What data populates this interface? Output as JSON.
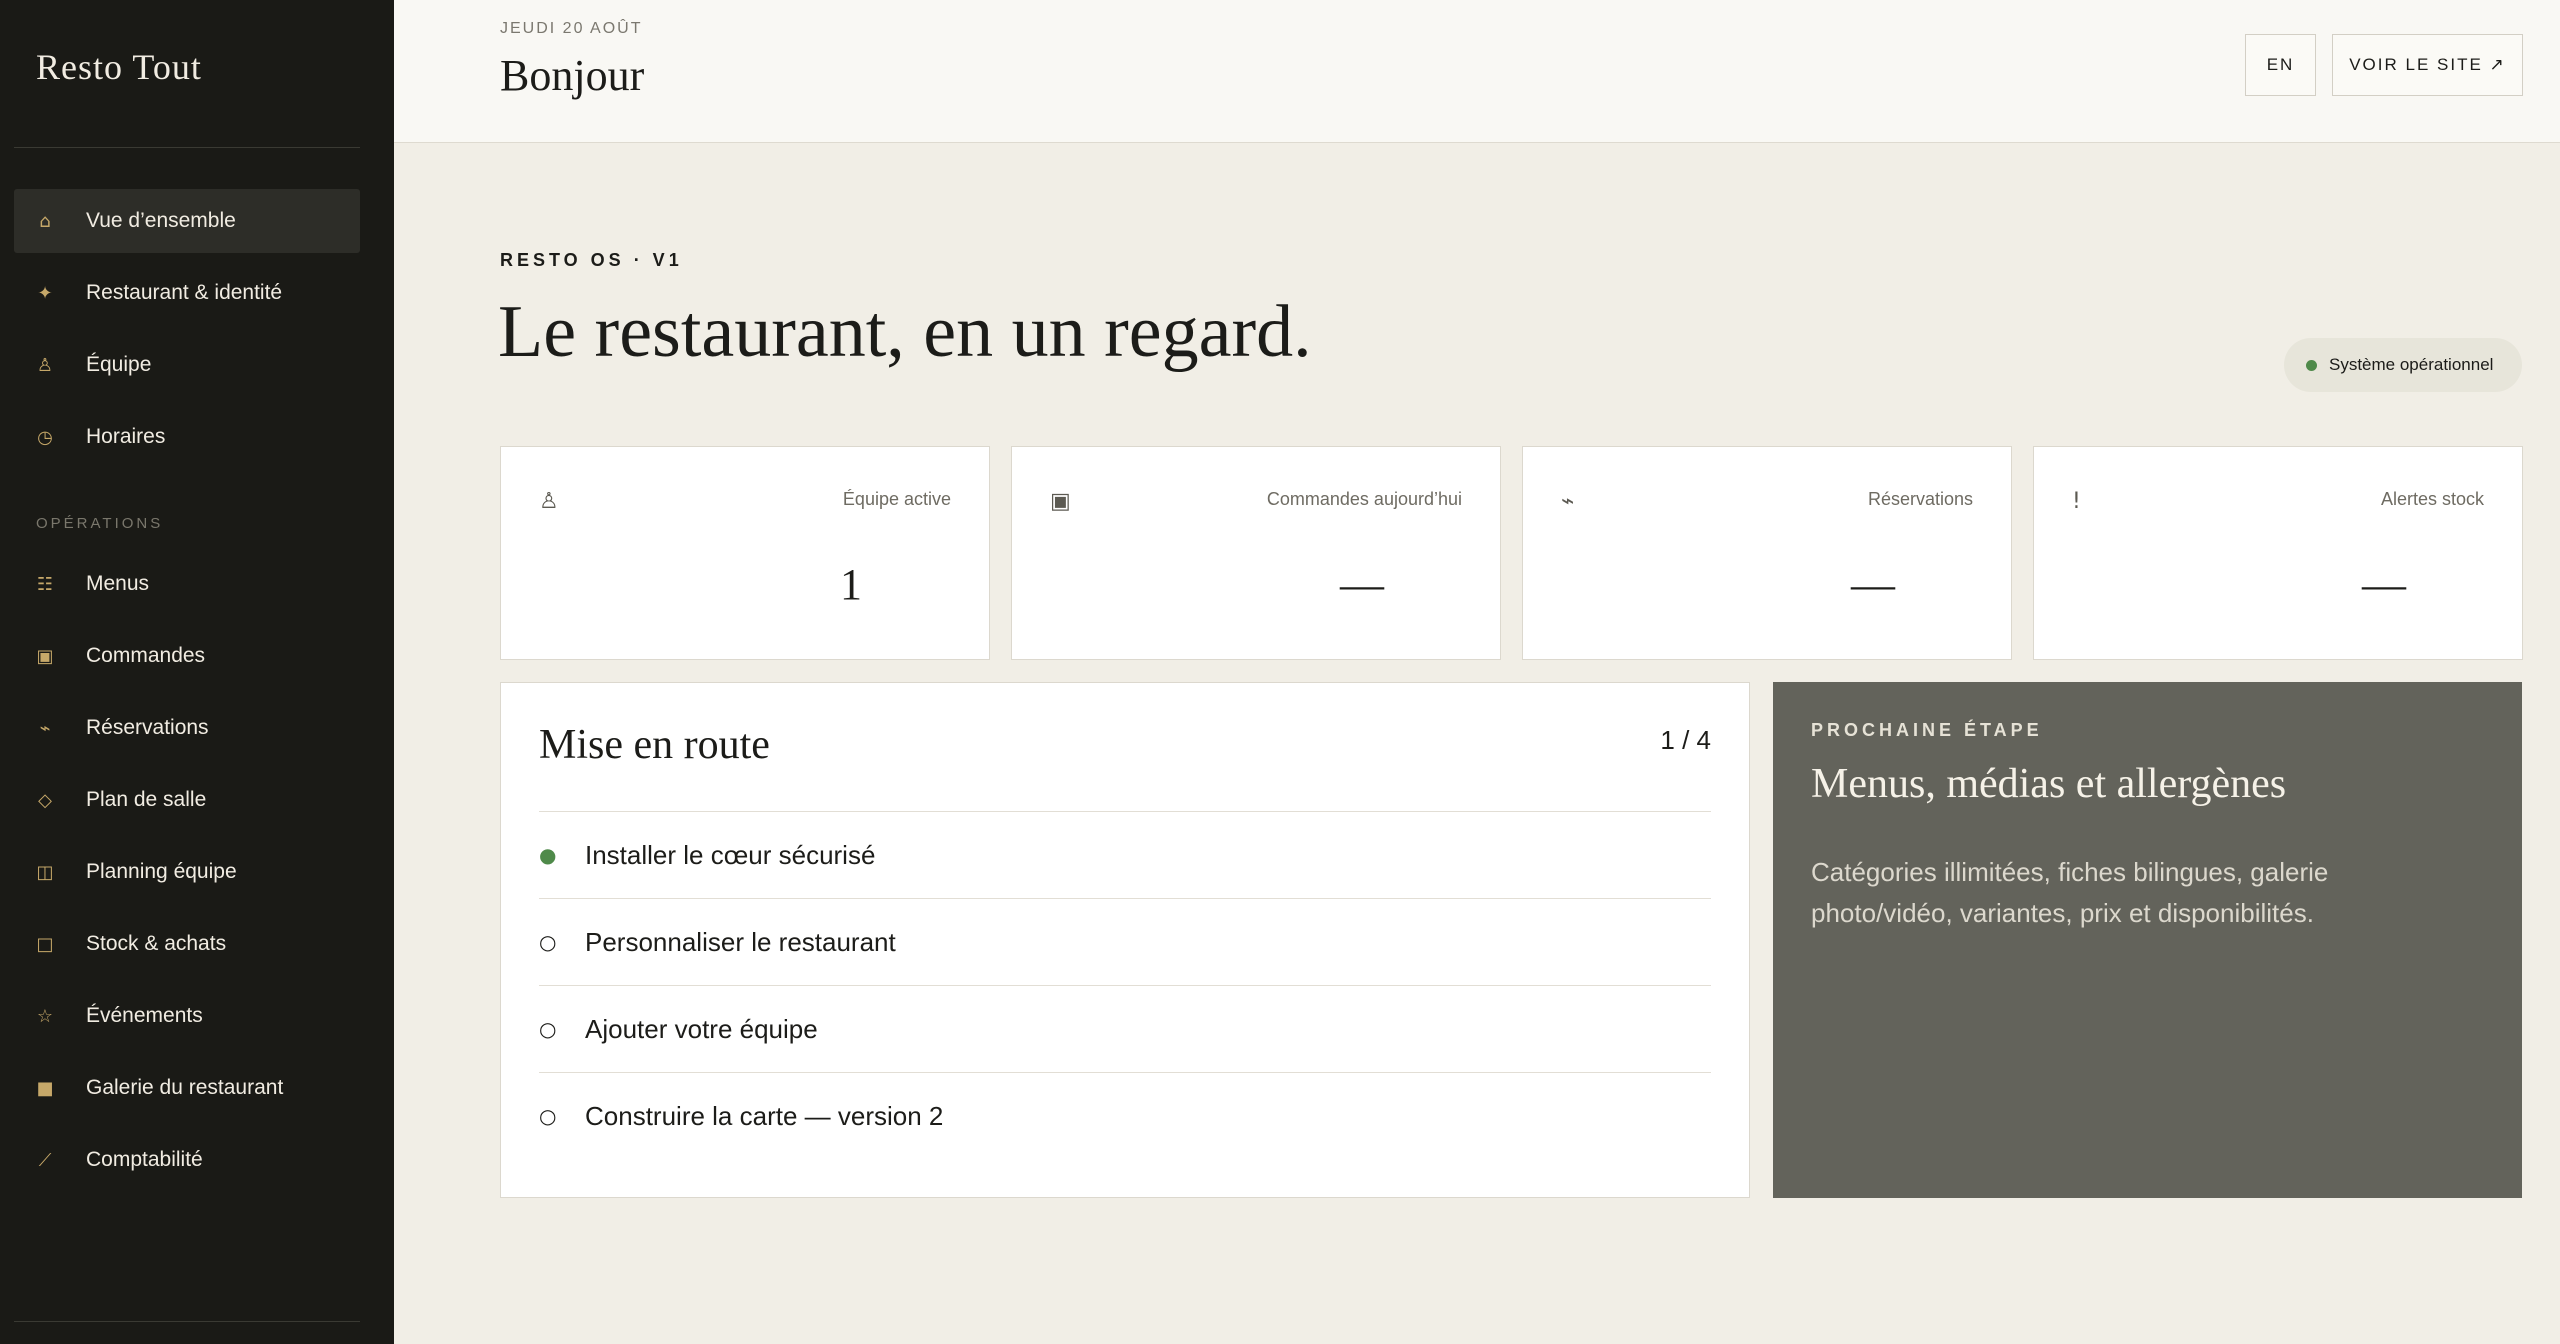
{
  "sidebar": {
    "brand": "Resto Tout",
    "primary_items": [
      {
        "icon": "⌂",
        "label": "Vue d’ensemble"
      },
      {
        "icon": "✦",
        "label": "Restaurant & identité"
      },
      {
        "icon": "♙",
        "label": "Équipe"
      },
      {
        "icon": "◷",
        "label": "Horaires"
      }
    ],
    "section_label": "OPÉRATIONS",
    "operations_items": [
      {
        "icon": "☷",
        "label": "Menus"
      },
      {
        "icon": "▣",
        "label": "Commandes"
      },
      {
        "icon": "⌁",
        "label": "Réservations"
      },
      {
        "icon": "◇",
        "label": "Plan de salle"
      },
      {
        "icon": "◫",
        "label": "Planning équipe"
      },
      {
        "icon": "□",
        "label": "Stock & achats"
      },
      {
        "icon": "☆",
        "label": "Événements"
      },
      {
        "icon": "■",
        "label": "Galerie du restaurant"
      },
      {
        "icon": "⟋",
        "label": "Comptabilité"
      }
    ]
  },
  "header": {
    "date": "JEUDI 20 AOÛT",
    "greeting": "Bonjour",
    "lang_button": "EN",
    "view_site_button": "VOIR LE SITE ↗"
  },
  "main": {
    "eyebrow": "RESTO OS · V1",
    "headline": "Le restaurant, en un regard.",
    "status": "Système opérationnel",
    "stats": [
      {
        "icon": "♙",
        "label": "Équipe active",
        "value": "1"
      },
      {
        "icon": "▣",
        "label": "Commandes aujourd’hui",
        "value": "—"
      },
      {
        "icon": "⌁",
        "label": "Réservations",
        "value": "—"
      },
      {
        "icon": "!",
        "label": "Alertes stock",
        "value": "—"
      }
    ],
    "setup": {
      "title": "Mise en route",
      "progress": "1 / 4",
      "steps": [
        {
          "mark": "●",
          "label": "Installer le cœur sécurisé"
        },
        {
          "mark": "○",
          "label": "Personnaliser le restaurant"
        },
        {
          "mark": "○",
          "label": "Ajouter votre équipe"
        },
        {
          "mark": "○",
          "label": "Construire la carte — version 2"
        }
      ]
    },
    "next_step": {
      "eyebrow": "PROCHAINE ÉTAPE",
      "title": "Menus, médias et allergènes",
      "description": "Catégories illimitées, fiches bilingues, galerie photo/vidéo, variantes, prix et disponibilités."
    }
  },
  "colors": {
    "sidebar_bg": "#1a1a16",
    "accent_gold": "#c6a869",
    "status_green": "#4f8a4a",
    "next_card_bg": "#63635b",
    "page_bg": "#f1eee6"
  }
}
